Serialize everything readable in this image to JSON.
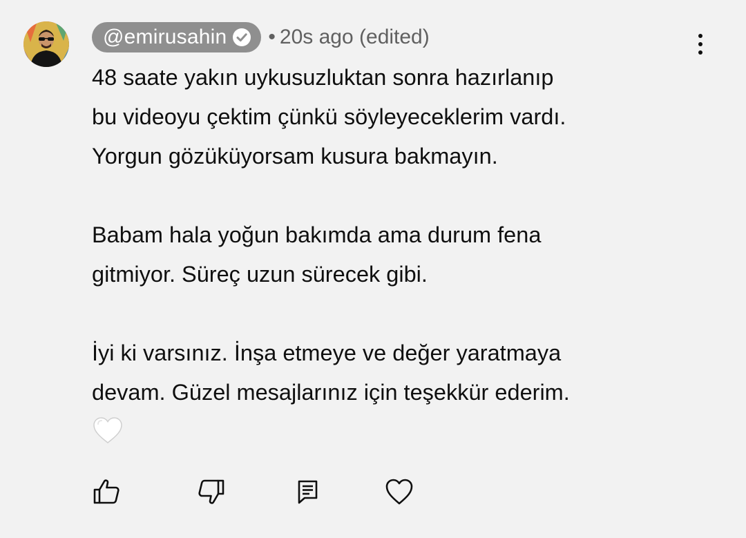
{
  "comment": {
    "author": "@emirusahin",
    "verified": true,
    "meta_separator": "•",
    "timestamp": "20s ago",
    "edited_label": "(edited)",
    "paragraphs": [
      "48 saate yakın uykusuzluktan sonra hazırlanıp\nbu videoyu çektim çünkü söyleyeceklerim vardı.\nYorgun gözüküyorsam kusura bakmayın.",
      "Babam hala yoğun bakımda ama durum fena\ngitmiyor. Süreç uzun sürecek gibi.",
      "İyi ki varsınız. İnşa etmeye ve değer yaratmaya\ndevam. Güzel mesajlarınız için teşekkür ederim."
    ],
    "trailing_emoji": "white-heart-emoji"
  },
  "actions": [
    {
      "name": "like",
      "icon": "thumbs-up-icon"
    },
    {
      "name": "dislike",
      "icon": "thumbs-down-icon"
    },
    {
      "name": "reply",
      "icon": "reply-comment-icon"
    },
    {
      "name": "heart",
      "icon": "heart-outline-icon"
    }
  ],
  "menu": {
    "icon": "more-vertical-icon"
  },
  "colors": {
    "background": "#f2f2f2",
    "author_chip": "#8f8f8f",
    "meta_text": "#606060",
    "body_text": "#0f0f0f"
  }
}
